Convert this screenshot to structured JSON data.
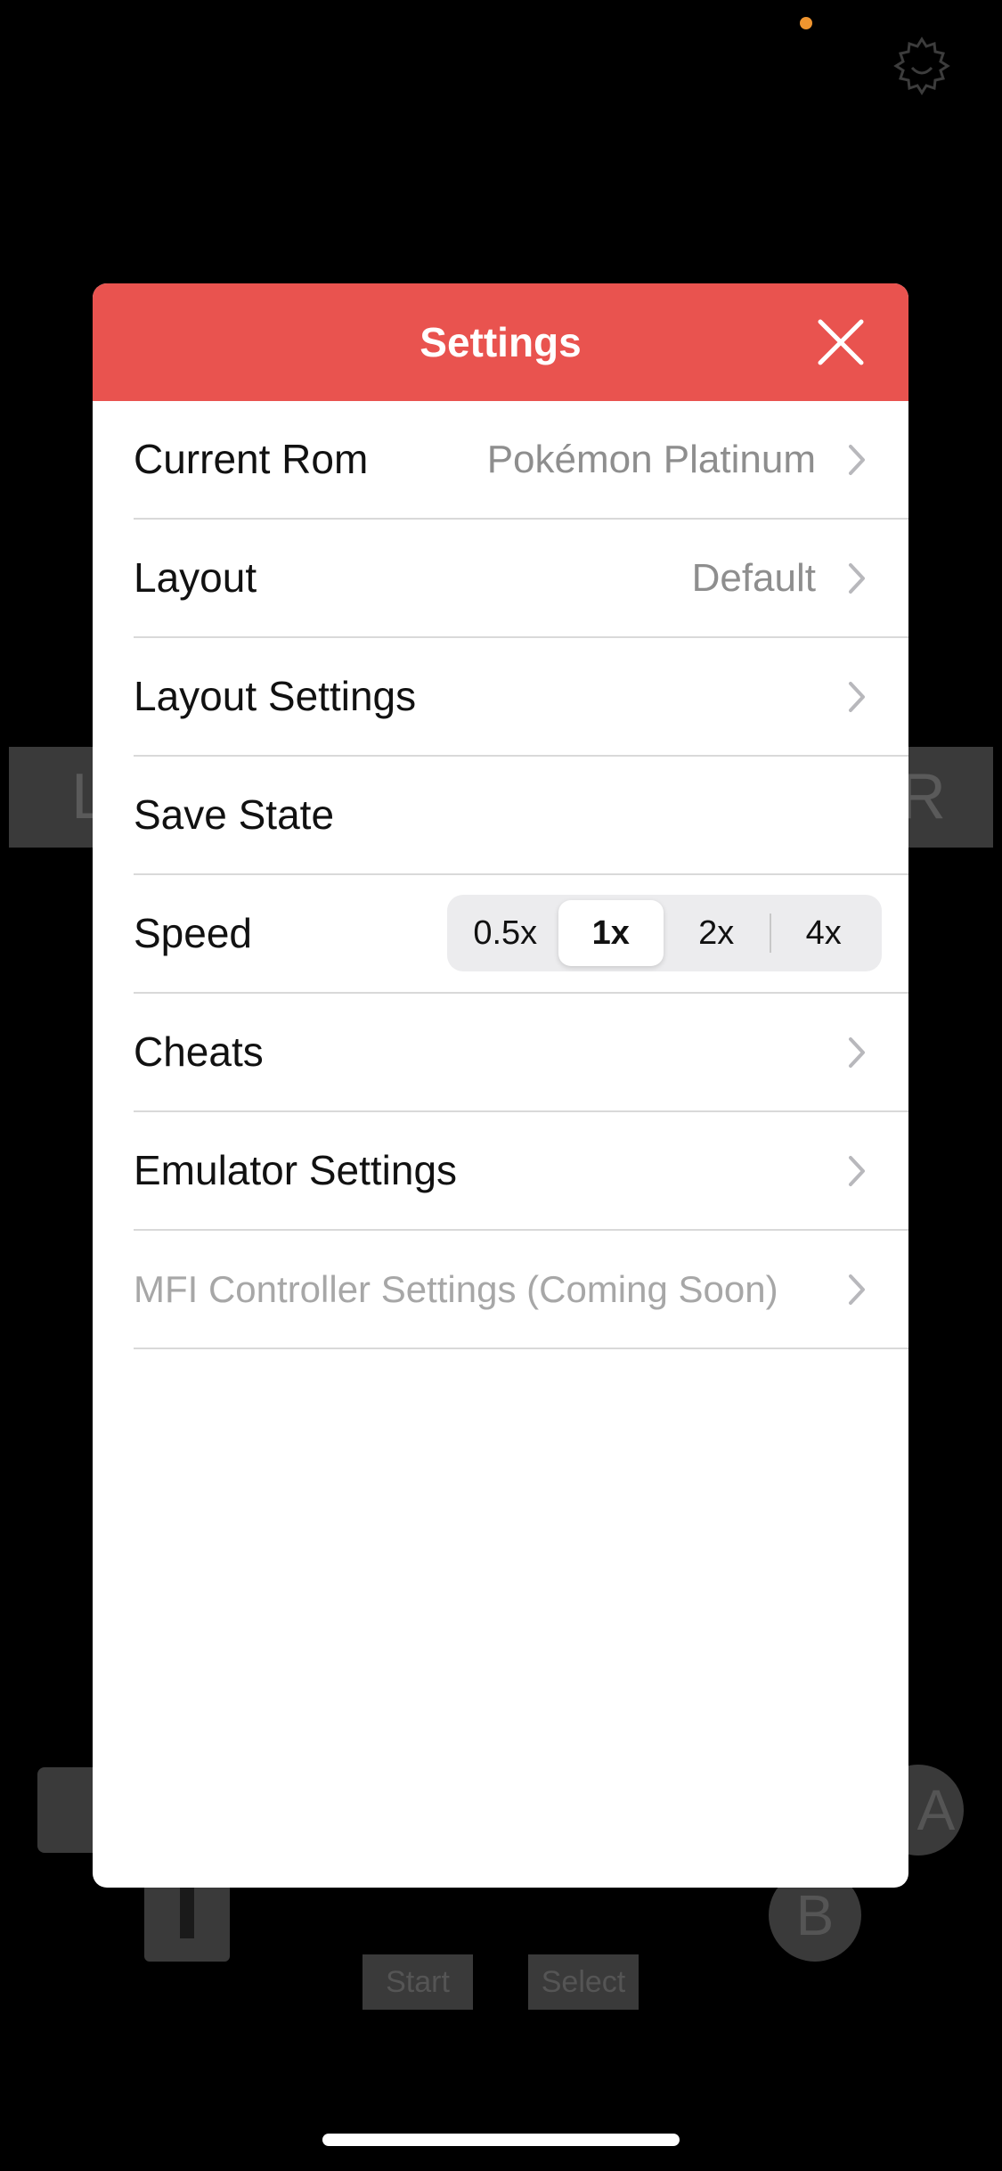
{
  "colors": {
    "header": "#e9534f",
    "status_dot": "#f0952f",
    "secondary_text": "#8e8e8e"
  },
  "background": {
    "shoulder_left": "L",
    "shoulder_right": "R",
    "button_a": "A",
    "button_b": "B",
    "start_label": "Start",
    "select_label": "Select"
  },
  "modal": {
    "title": "Settings",
    "close_icon": "close-icon",
    "rows": [
      {
        "label": "Current Rom",
        "value": "Pokémon Platinum",
        "chevron": true
      },
      {
        "label": "Layout",
        "value": "Default",
        "chevron": true
      },
      {
        "label": "Layout Settings",
        "chevron": true
      },
      {
        "label": "Save State",
        "chevron": false
      },
      {
        "label": "Speed",
        "options": [
          "0.5x",
          "1x",
          "2x",
          "4x"
        ],
        "selected": "1x"
      },
      {
        "label": "Cheats",
        "chevron": true
      },
      {
        "label": "Emulator Settings",
        "chevron": true
      },
      {
        "label": "MFI Controller Settings (Coming Soon)",
        "chevron": true,
        "disabled": true
      }
    ]
  }
}
